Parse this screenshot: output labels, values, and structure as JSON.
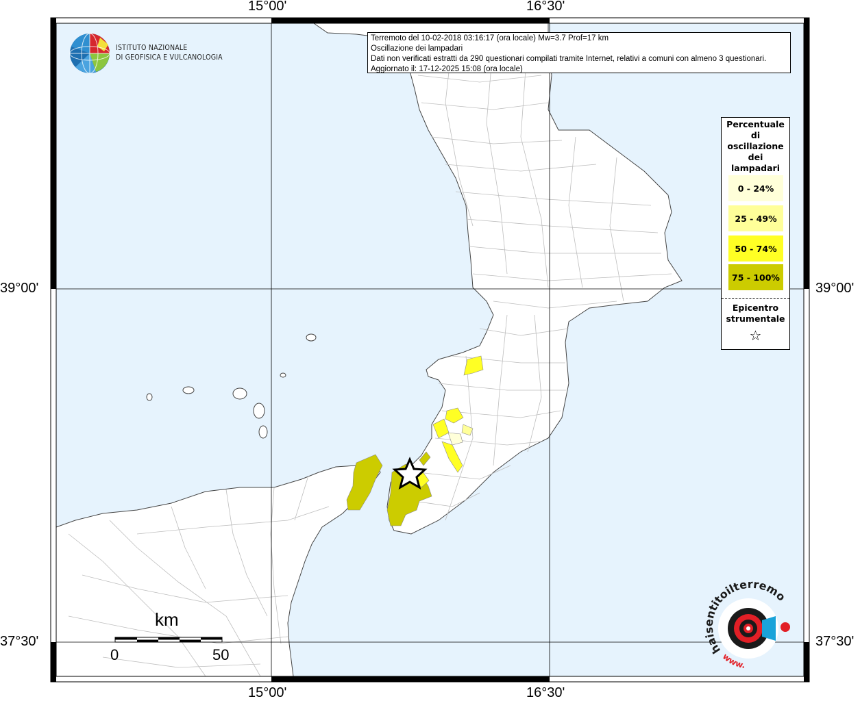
{
  "map": {
    "info_lines": [
      "Terremoto del 10-02-2018 03:16:17 (ora locale) Mw=3.7 Prof=17 km",
      "Oscillazione dei lampadari",
      "Dati non verificati estratti da 290 questionari compilati tramite Internet, relativi a comuni con almeno 3 questionari.",
      "Aggiornato il: 17-12-2025 15:08 (ora locale)"
    ],
    "axes": {
      "lon_top": [
        "15°00'",
        "16°30'"
      ],
      "lon_bottom": [
        "15°00'",
        "16°30'"
      ],
      "lat_left": [
        "39°00'",
        "37°30'"
      ],
      "lat_right": [
        "39°00'",
        "37°30'"
      ]
    },
    "institute_logo": {
      "line1": "ISTITUTO NAZIONALE",
      "line2": "DI GEOFISICA E VULCANOLOGIA"
    },
    "legend": {
      "title_lines": [
        "Percentuale",
        "di",
        "oscillazione",
        "dei",
        "lampadari"
      ],
      "items": [
        {
          "label": "0 - 24%",
          "color": "#ffffd9"
        },
        {
          "label": "25 - 49%",
          "color": "#ffff99"
        },
        {
          "label": "50 - 74%",
          "color": "#ffff24"
        },
        {
          "label": "75 - 100%",
          "color": "#cccc00"
        }
      ],
      "epicenter_lines": [
        "Epicentro",
        "strumentale"
      ],
      "epicenter_symbol": "☆"
    },
    "scale_bar": {
      "unit": "km",
      "start": "0",
      "end": "50"
    },
    "colors": {
      "sea": "#e6f3fd",
      "land": "#ffffff",
      "frame": "#000000"
    },
    "haisentito_logo": {
      "text": "haisentitoilterremoto.it",
      "www": "www."
    }
  }
}
